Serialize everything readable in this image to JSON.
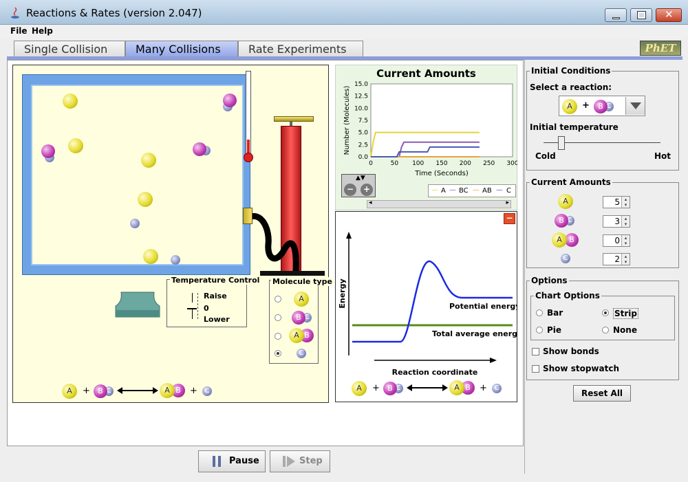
{
  "window": {
    "title": "Reactions & Rates (version 2.047)"
  },
  "menu": {
    "file": "File",
    "help": "Help"
  },
  "tabs": [
    {
      "label": "Single Collision",
      "active": false
    },
    {
      "label": "Many Collisions",
      "active": true
    },
    {
      "label": "Rate Experiments",
      "active": false
    }
  ],
  "logo": {
    "text": "PhET"
  },
  "temperature_control": {
    "title": "Temperature Control",
    "raise": "Raise",
    "zero": "0",
    "lower": "Lower"
  },
  "molecule_type": {
    "title": "Molecule type",
    "options": [
      "A",
      "BC",
      "AB",
      "C"
    ],
    "selected": "C"
  },
  "equation": {
    "left1": "A",
    "left2": "BC",
    "right1": "AB",
    "right2": "C",
    "plus": "+"
  },
  "chart": {
    "title": "Current Amounts",
    "ylabel": "Number (Molecules)",
    "xlabel": "Time (Seconds)",
    "yticks": [
      "15.0",
      "12.5",
      "10.0",
      "7.5",
      "5.0",
      "2.5",
      "0.0"
    ],
    "xticks": [
      "0",
      "50",
      "100",
      "150",
      "200",
      "250",
      "300"
    ],
    "legend": [
      "A",
      "BC",
      "AB",
      "C"
    ]
  },
  "chart_data": {
    "type": "line",
    "title": "Current Amounts",
    "xlabel": "Time (Seconds)",
    "ylabel": "Number (Molecules)",
    "xlim": [
      0,
      300
    ],
    "ylim": [
      0,
      15
    ],
    "series": [
      {
        "name": "A",
        "color": "#e8d23a",
        "x": [
          0,
          5,
          10,
          230
        ],
        "y": [
          0,
          3,
          5,
          5
        ]
      },
      {
        "name": "BC",
        "color": "#8a5ab8",
        "x": [
          0,
          60,
          65,
          70,
          230
        ],
        "y": [
          0,
          0,
          2,
          3,
          3
        ]
      },
      {
        "name": "AB",
        "color": "#e8a23a",
        "x": [
          0,
          230
        ],
        "y": [
          0,
          0
        ]
      },
      {
        "name": "C",
        "color": "#4a5ab0",
        "x": [
          0,
          55,
          60,
          120,
          125,
          230
        ],
        "y": [
          0,
          0,
          1,
          1,
          2,
          2
        ]
      }
    ]
  },
  "energy": {
    "ylabel": "Energy",
    "xlabel": "Reaction coordinate",
    "potential": "Potential energy",
    "total": "Total average energy"
  },
  "controls": {
    "pause": "Pause",
    "step": "Step"
  },
  "initial_conditions": {
    "title": "Initial Conditions",
    "select_label": "Select a reaction:",
    "reaction": {
      "a": "A",
      "bc": "BC",
      "plus": "+"
    },
    "temp_label": "Initial temperature",
    "cold": "Cold",
    "hot": "Hot",
    "temperature_fraction": 0.15
  },
  "current_amounts": {
    "title": "Current Amounts",
    "rows": [
      {
        "mol": "A",
        "value": "5"
      },
      {
        "mol": "BC",
        "value": "3"
      },
      {
        "mol": "AB",
        "value": "0"
      },
      {
        "mol": "C",
        "value": "2"
      }
    ]
  },
  "options": {
    "title": "Options",
    "chart_title": "Chart Options",
    "bar": "Bar",
    "strip": "Strip",
    "pie": "Pie",
    "none": "None",
    "selected": "Strip",
    "show_bonds": "Show bonds",
    "show_stopwatch": "Show stopwatch"
  },
  "reset": "Reset All",
  "colors": {
    "accent": "#8d9eda",
    "panel": "#ffffe0",
    "box": "#6ea4e5"
  }
}
